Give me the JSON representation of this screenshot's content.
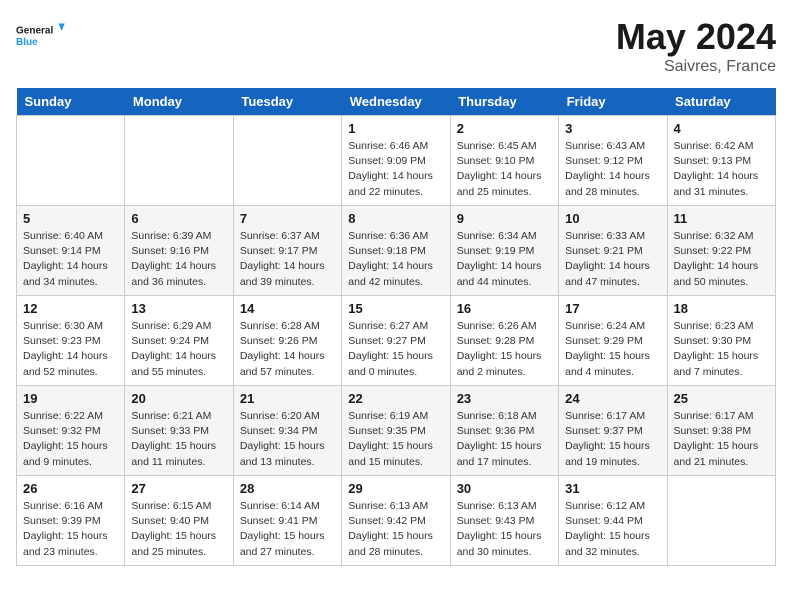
{
  "header": {
    "logo_line1": "General",
    "logo_line2": "Blue",
    "month_year": "May 2024",
    "location": "Saivres, France"
  },
  "days_of_week": [
    "Sunday",
    "Monday",
    "Tuesday",
    "Wednesday",
    "Thursday",
    "Friday",
    "Saturday"
  ],
  "weeks": [
    [
      {
        "day": "",
        "info": ""
      },
      {
        "day": "",
        "info": ""
      },
      {
        "day": "",
        "info": ""
      },
      {
        "day": "1",
        "info": "Sunrise: 6:46 AM\nSunset: 9:09 PM\nDaylight: 14 hours\nand 22 minutes."
      },
      {
        "day": "2",
        "info": "Sunrise: 6:45 AM\nSunset: 9:10 PM\nDaylight: 14 hours\nand 25 minutes."
      },
      {
        "day": "3",
        "info": "Sunrise: 6:43 AM\nSunset: 9:12 PM\nDaylight: 14 hours\nand 28 minutes."
      },
      {
        "day": "4",
        "info": "Sunrise: 6:42 AM\nSunset: 9:13 PM\nDaylight: 14 hours\nand 31 minutes."
      }
    ],
    [
      {
        "day": "5",
        "info": "Sunrise: 6:40 AM\nSunset: 9:14 PM\nDaylight: 14 hours\nand 34 minutes."
      },
      {
        "day": "6",
        "info": "Sunrise: 6:39 AM\nSunset: 9:16 PM\nDaylight: 14 hours\nand 36 minutes."
      },
      {
        "day": "7",
        "info": "Sunrise: 6:37 AM\nSunset: 9:17 PM\nDaylight: 14 hours\nand 39 minutes."
      },
      {
        "day": "8",
        "info": "Sunrise: 6:36 AM\nSunset: 9:18 PM\nDaylight: 14 hours\nand 42 minutes."
      },
      {
        "day": "9",
        "info": "Sunrise: 6:34 AM\nSunset: 9:19 PM\nDaylight: 14 hours\nand 44 minutes."
      },
      {
        "day": "10",
        "info": "Sunrise: 6:33 AM\nSunset: 9:21 PM\nDaylight: 14 hours\nand 47 minutes."
      },
      {
        "day": "11",
        "info": "Sunrise: 6:32 AM\nSunset: 9:22 PM\nDaylight: 14 hours\nand 50 minutes."
      }
    ],
    [
      {
        "day": "12",
        "info": "Sunrise: 6:30 AM\nSunset: 9:23 PM\nDaylight: 14 hours\nand 52 minutes."
      },
      {
        "day": "13",
        "info": "Sunrise: 6:29 AM\nSunset: 9:24 PM\nDaylight: 14 hours\nand 55 minutes."
      },
      {
        "day": "14",
        "info": "Sunrise: 6:28 AM\nSunset: 9:26 PM\nDaylight: 14 hours\nand 57 minutes."
      },
      {
        "day": "15",
        "info": "Sunrise: 6:27 AM\nSunset: 9:27 PM\nDaylight: 15 hours\nand 0 minutes."
      },
      {
        "day": "16",
        "info": "Sunrise: 6:26 AM\nSunset: 9:28 PM\nDaylight: 15 hours\nand 2 minutes."
      },
      {
        "day": "17",
        "info": "Sunrise: 6:24 AM\nSunset: 9:29 PM\nDaylight: 15 hours\nand 4 minutes."
      },
      {
        "day": "18",
        "info": "Sunrise: 6:23 AM\nSunset: 9:30 PM\nDaylight: 15 hours\nand 7 minutes."
      }
    ],
    [
      {
        "day": "19",
        "info": "Sunrise: 6:22 AM\nSunset: 9:32 PM\nDaylight: 15 hours\nand 9 minutes."
      },
      {
        "day": "20",
        "info": "Sunrise: 6:21 AM\nSunset: 9:33 PM\nDaylight: 15 hours\nand 11 minutes."
      },
      {
        "day": "21",
        "info": "Sunrise: 6:20 AM\nSunset: 9:34 PM\nDaylight: 15 hours\nand 13 minutes."
      },
      {
        "day": "22",
        "info": "Sunrise: 6:19 AM\nSunset: 9:35 PM\nDaylight: 15 hours\nand 15 minutes."
      },
      {
        "day": "23",
        "info": "Sunrise: 6:18 AM\nSunset: 9:36 PM\nDaylight: 15 hours\nand 17 minutes."
      },
      {
        "day": "24",
        "info": "Sunrise: 6:17 AM\nSunset: 9:37 PM\nDaylight: 15 hours\nand 19 minutes."
      },
      {
        "day": "25",
        "info": "Sunrise: 6:17 AM\nSunset: 9:38 PM\nDaylight: 15 hours\nand 21 minutes."
      }
    ],
    [
      {
        "day": "26",
        "info": "Sunrise: 6:16 AM\nSunset: 9:39 PM\nDaylight: 15 hours\nand 23 minutes."
      },
      {
        "day": "27",
        "info": "Sunrise: 6:15 AM\nSunset: 9:40 PM\nDaylight: 15 hours\nand 25 minutes."
      },
      {
        "day": "28",
        "info": "Sunrise: 6:14 AM\nSunset: 9:41 PM\nDaylight: 15 hours\nand 27 minutes."
      },
      {
        "day": "29",
        "info": "Sunrise: 6:13 AM\nSunset: 9:42 PM\nDaylight: 15 hours\nand 28 minutes."
      },
      {
        "day": "30",
        "info": "Sunrise: 6:13 AM\nSunset: 9:43 PM\nDaylight: 15 hours\nand 30 minutes."
      },
      {
        "day": "31",
        "info": "Sunrise: 6:12 AM\nSunset: 9:44 PM\nDaylight: 15 hours\nand 32 minutes."
      },
      {
        "day": "",
        "info": ""
      }
    ]
  ]
}
